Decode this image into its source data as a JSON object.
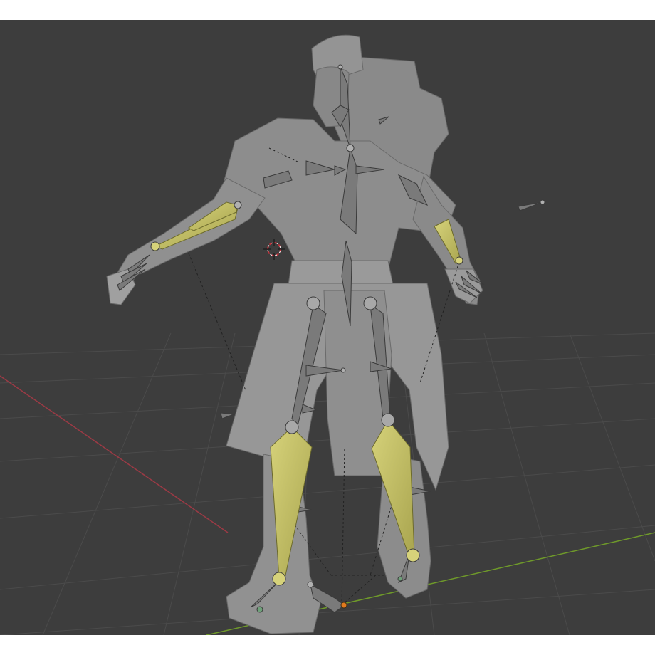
{
  "viewport": {
    "background": "#3d3d3d",
    "grid_color": "#4a4a4a",
    "x_axis_color": "#9c3a45",
    "y_axis_color": "#6f9a2a",
    "mesh_color": "#8e8e8e",
    "bone_color": "#7a7a7a",
    "selected_bone_color": "#c8c46a",
    "cursor_color": "#c0303a",
    "origin_color": "#e07a1f"
  },
  "icons": [
    "3d-cursor-icon",
    "origin-icon"
  ]
}
